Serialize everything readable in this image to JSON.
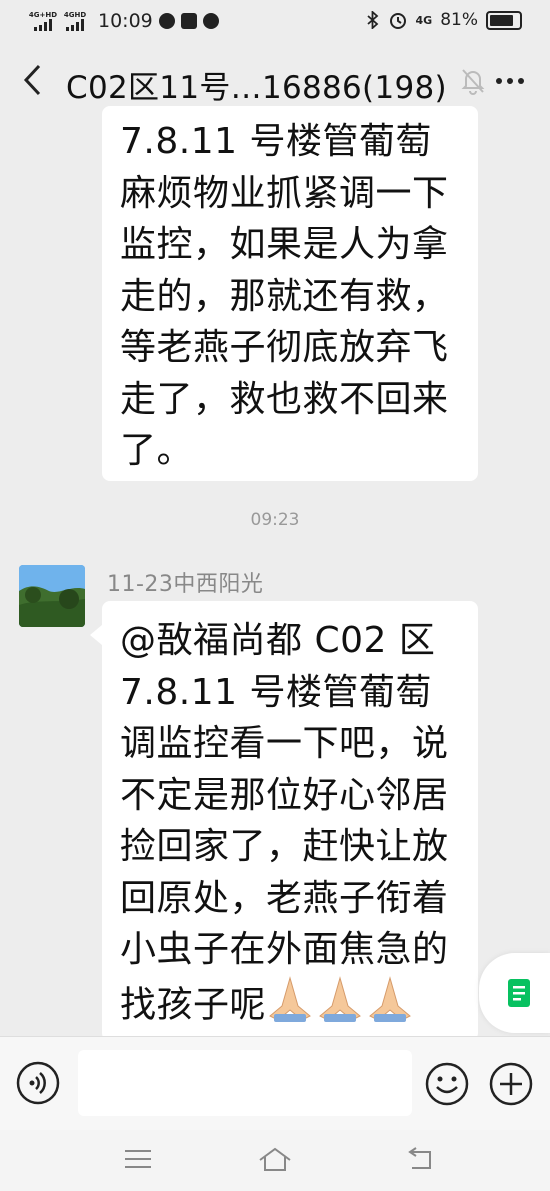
{
  "status_bar": {
    "sim1_label": "4G+HD",
    "sim2_label": "4GHD",
    "time": "10:09",
    "net_label": "4G",
    "battery": "81%"
  },
  "header": {
    "title": "C02区11号…16886(198)",
    "back_icon": "chevron-left-icon",
    "mute_icon": "bell-off-icon",
    "more_icon": "more-dots-icon"
  },
  "messages": [
    {
      "lines": [
        "7.8.11 号楼管葡萄",
        "麻烦物业抓紧调一下",
        "监控，如果是人为拿",
        "走的，那就还有救，",
        "等老燕子彻底放弃飞",
        "走了，救也救不回来",
        "了。"
      ]
    },
    {
      "timestamp": "09:23",
      "sender": "11-23中西阳光",
      "lines": [
        "@敔福尚都 C02 区",
        "7.8.11 号楼管葡萄",
        "调监控看一下吧，说",
        "不定是那位好心邻居",
        "捡回家了，赶快让放",
        "回原处，老燕子衔着",
        "小虫子在外面焦急的",
        "找孩子呢"
      ],
      "emoji": "pray-hands x3"
    }
  ],
  "input_bar": {
    "placeholder": "",
    "voice_icon": "voice-icon",
    "emoji_icon": "smiley-icon",
    "plus_icon": "plus-circle-icon"
  },
  "colors": {
    "background": "#ededed",
    "bubble": "#ffffff",
    "accent_green": "#07c160"
  }
}
